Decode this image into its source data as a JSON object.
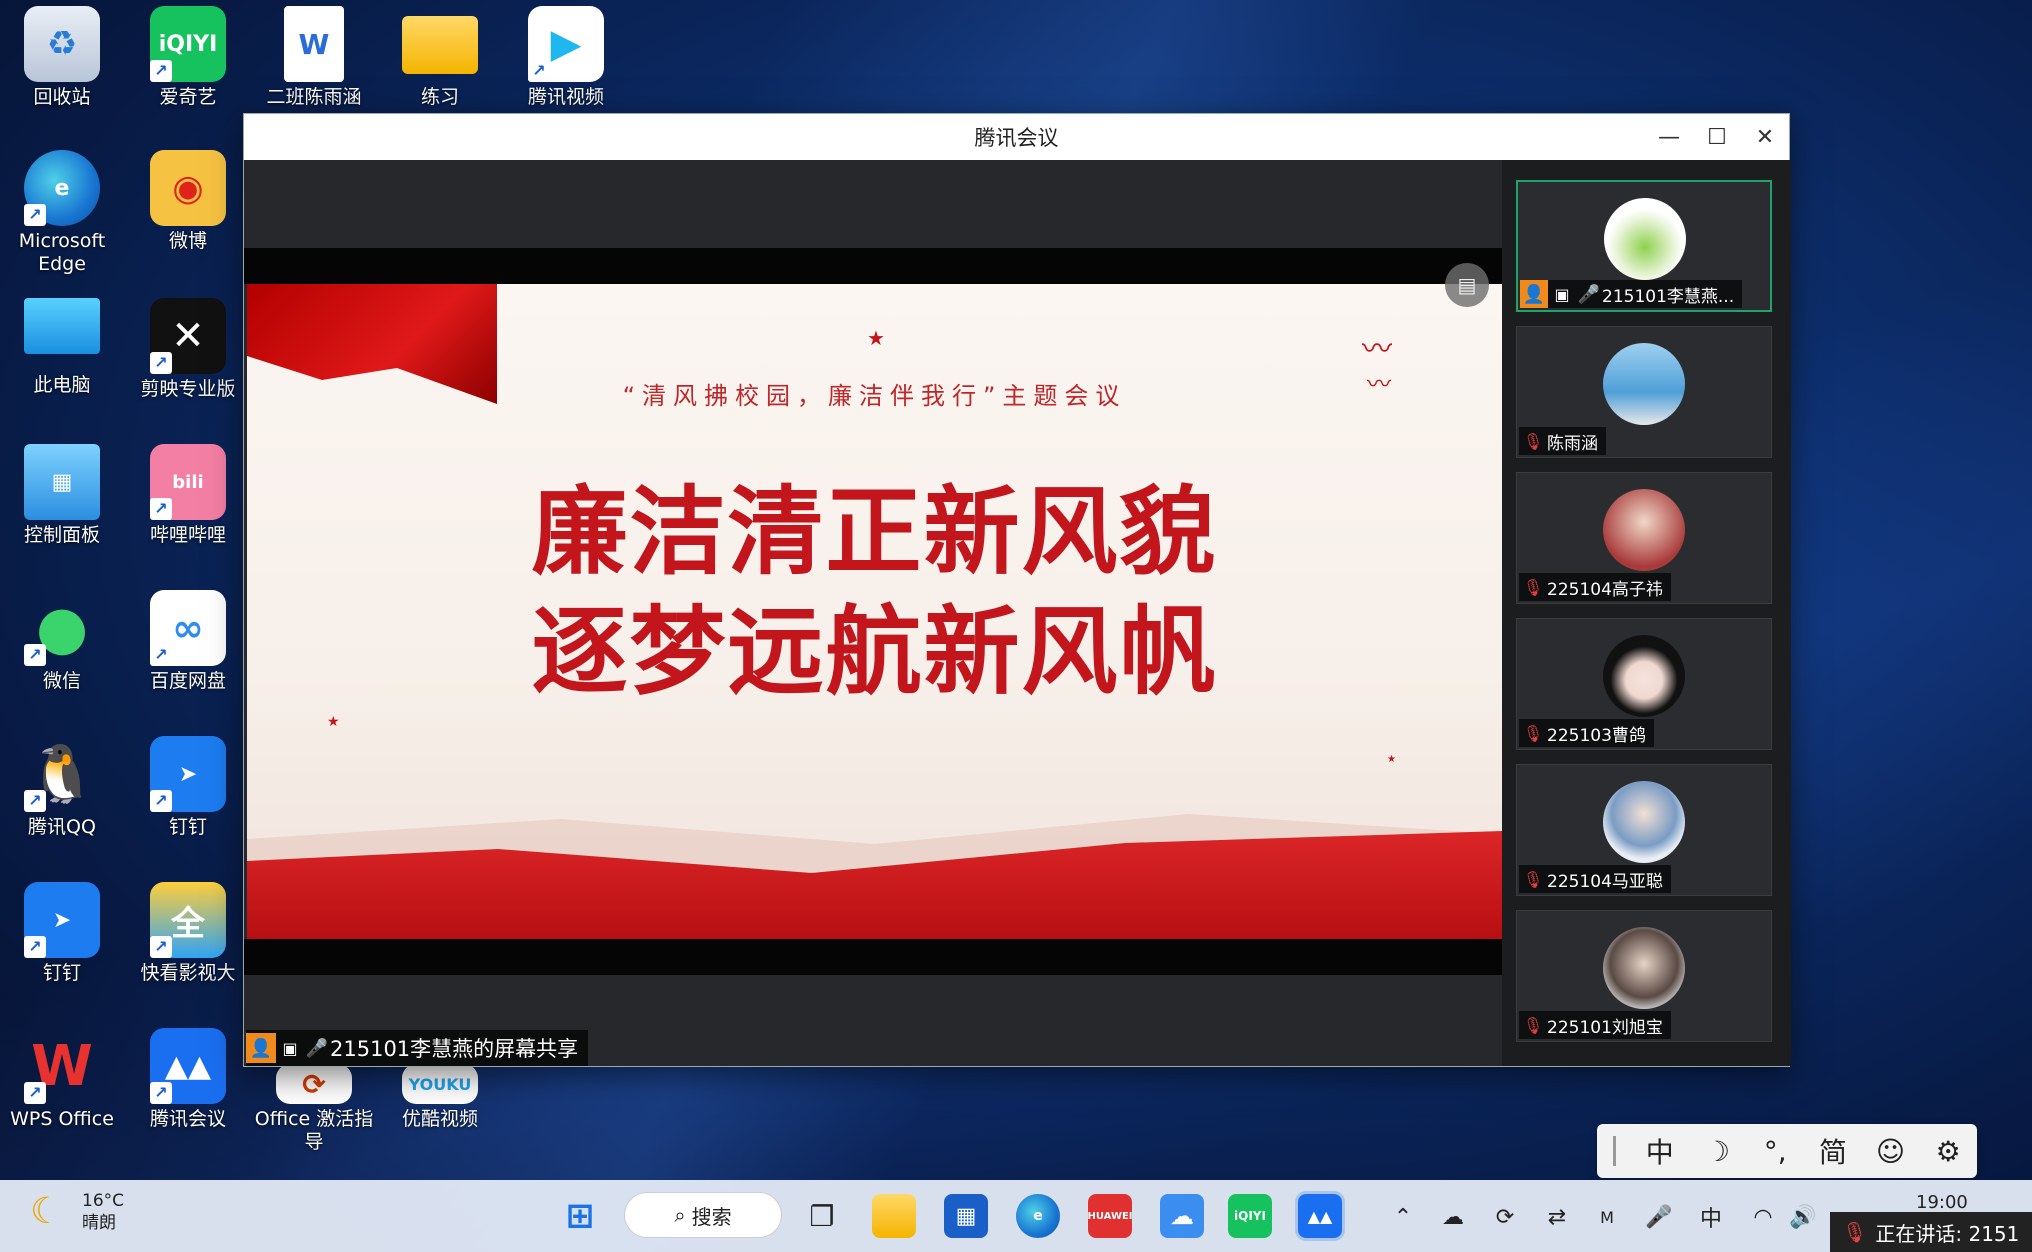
{
  "desktop": {
    "icons": [
      {
        "label": "回收站"
      },
      {
        "label": "爱奇艺"
      },
      {
        "label": "二班陈雨涵"
      },
      {
        "label": "练习"
      },
      {
        "label": "腾讯视频"
      },
      {
        "label": "Microsoft Edge"
      },
      {
        "label": "微博"
      },
      {
        "label": "此电脑"
      },
      {
        "label": "剪映专业版"
      },
      {
        "label": "控制面板"
      },
      {
        "label": "哔哩哔哩"
      },
      {
        "label": "微信"
      },
      {
        "label": "百度网盘"
      },
      {
        "label": "腾讯QQ"
      },
      {
        "label": "钉钉"
      },
      {
        "label": "钉钉"
      },
      {
        "label": "快看影视大"
      },
      {
        "label": "WPS Office"
      },
      {
        "label": "腾讯会议"
      },
      {
        "label": "Office 激活指导"
      },
      {
        "label": "优酷视频"
      }
    ]
  },
  "window": {
    "title": "腾讯会议",
    "minimize": "—",
    "maximize": "☐",
    "close": "✕"
  },
  "slide": {
    "subtitle": "“清风拂校园，廉洁伴我行”主题会议",
    "line1": "廉洁清正新风貌",
    "line2": "逐梦远航新风帆"
  },
  "share": {
    "label": "215101李慧燕的屏幕共享"
  },
  "participants": [
    {
      "name": "215101李慧燕...",
      "host": true
    },
    {
      "name": "陈雨涵",
      "host": false
    },
    {
      "name": "225104高子祎",
      "host": false
    },
    {
      "name": "225103曹鸽",
      "host": false
    },
    {
      "name": "225104马亚聪",
      "host": false
    },
    {
      "name": "225101刘旭宝",
      "host": false
    }
  ],
  "ime": {
    "items": [
      "中",
      "☽",
      "°,",
      "简",
      "☺",
      "⚙"
    ]
  },
  "taskbar": {
    "weather_temp": "16°C",
    "weather_desc": "晴朗",
    "search_label": "搜索",
    "ime_lang": "中",
    "time": "19:00",
    "speaking": "正在讲话: 2151"
  }
}
